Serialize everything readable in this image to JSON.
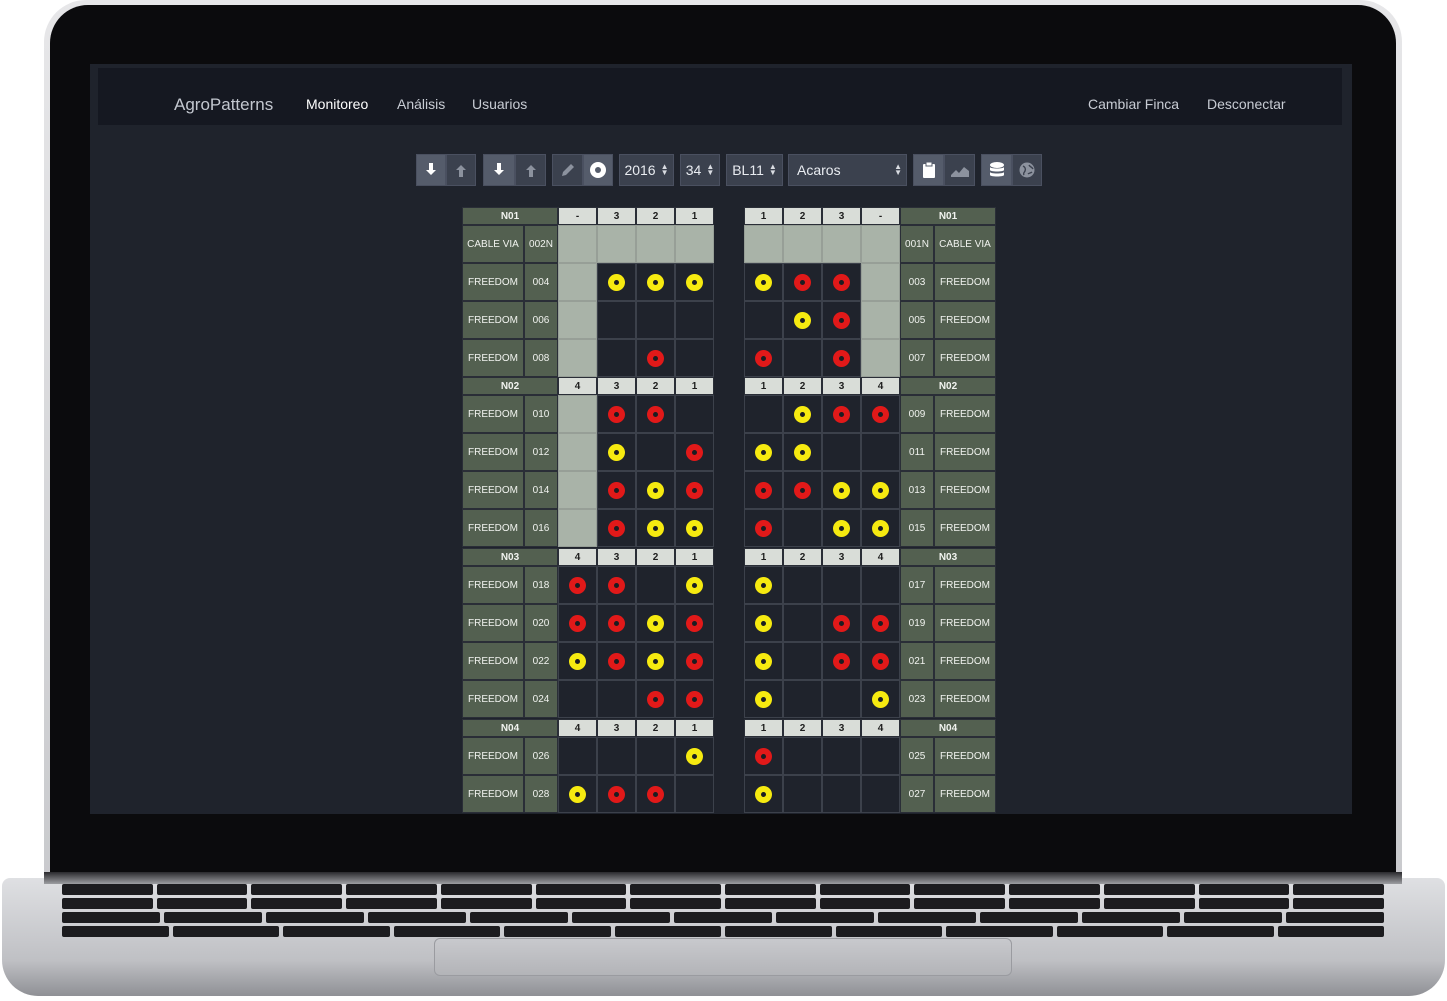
{
  "app": {
    "brand": "AgroPatterns",
    "nav": [
      "Monitoreo",
      "Análisis",
      "Usuarios"
    ],
    "nav_right": [
      "Cambiar Finca",
      "Desconectar"
    ]
  },
  "toolbar": {
    "year": "2016",
    "week": "34",
    "block": "BL11",
    "pest": "Acaros",
    "icons": [
      "download-icon",
      "upload-icon",
      "download-icon",
      "upload-icon",
      "pencil-icon",
      "target-icon",
      "clipboard-icon",
      "area-chart-icon",
      "database-icon",
      "globe-icon"
    ]
  },
  "colors": {
    "red": "#e11919",
    "yellow": "#f6ea10",
    "label_bg": "#536050",
    "empty_bed": "#a9b3a8"
  },
  "grid": {
    "sections": [
      {
        "name": "N01",
        "left_cols": [
          "-",
          "3",
          "2",
          "1"
        ],
        "right_cols": [
          "1",
          "2",
          "3",
          "-"
        ],
        "rows": [
          {
            "l_var": "CABLE VIA",
            "l_id": "002N",
            "left": [
              "g",
              "g",
              "g",
              "g"
            ],
            "right": [
              "g",
              "g",
              "g",
              "g"
            ],
            "r_id": "001N",
            "r_var": "CABLE VIA"
          },
          {
            "l_var": "FREEDOM",
            "l_id": "004",
            "left": [
              "g",
              "y",
              "y",
              "y"
            ],
            "right": [
              "y",
              "r",
              "r",
              "g"
            ],
            "r_id": "003",
            "r_var": "FREEDOM"
          },
          {
            "l_var": "FREEDOM",
            "l_id": "006",
            "left": [
              "g",
              "e",
              "e",
              "e"
            ],
            "right": [
              "e",
              "y",
              "r",
              "g"
            ],
            "r_id": "005",
            "r_var": "FREEDOM"
          },
          {
            "l_var": "FREEDOM",
            "l_id": "008",
            "left": [
              "g",
              "e",
              "r",
              "e"
            ],
            "right": [
              "r",
              "e",
              "r",
              "g"
            ],
            "r_id": "007",
            "r_var": "FREEDOM"
          }
        ]
      },
      {
        "name": "N02",
        "left_cols": [
          "4",
          "3",
          "2",
          "1"
        ],
        "right_cols": [
          "1",
          "2",
          "3",
          "4"
        ],
        "rows": [
          {
            "l_var": "FREEDOM",
            "l_id": "010",
            "left": [
              "g",
              "r",
              "r",
              "e"
            ],
            "right": [
              "e",
              "y",
              "r",
              "r"
            ],
            "r_id": "009",
            "r_var": "FREEDOM"
          },
          {
            "l_var": "FREEDOM",
            "l_id": "012",
            "left": [
              "g",
              "y",
              "e",
              "r"
            ],
            "right": [
              "y",
              "y",
              "e",
              "e"
            ],
            "r_id": "011",
            "r_var": "FREEDOM"
          },
          {
            "l_var": "FREEDOM",
            "l_id": "014",
            "left": [
              "g",
              "r",
              "y",
              "r"
            ],
            "right": [
              "r",
              "r",
              "y",
              "y"
            ],
            "r_id": "013",
            "r_var": "FREEDOM"
          },
          {
            "l_var": "FREEDOM",
            "l_id": "016",
            "left": [
              "g",
              "r",
              "y",
              "y"
            ],
            "right": [
              "r",
              "e",
              "y",
              "y"
            ],
            "r_id": "015",
            "r_var": "FREEDOM"
          }
        ]
      },
      {
        "name": "N03",
        "left_cols": [
          "4",
          "3",
          "2",
          "1"
        ],
        "right_cols": [
          "1",
          "2",
          "3",
          "4"
        ],
        "rows": [
          {
            "l_var": "FREEDOM",
            "l_id": "018",
            "left": [
              "r",
              "r",
              "e",
              "y"
            ],
            "right": [
              "y",
              "e",
              "e",
              "e"
            ],
            "r_id": "017",
            "r_var": "FREEDOM"
          },
          {
            "l_var": "FREEDOM",
            "l_id": "020",
            "left": [
              "r",
              "r",
              "y",
              "r"
            ],
            "right": [
              "y",
              "e",
              "r",
              "r"
            ],
            "r_id": "019",
            "r_var": "FREEDOM"
          },
          {
            "l_var": "FREEDOM",
            "l_id": "022",
            "left": [
              "y",
              "r",
              "y",
              "r"
            ],
            "right": [
              "y",
              "e",
              "r",
              "r"
            ],
            "r_id": "021",
            "r_var": "FREEDOM"
          },
          {
            "l_var": "FREEDOM",
            "l_id": "024",
            "left": [
              "e",
              "e",
              "r",
              "r"
            ],
            "right": [
              "y",
              "e",
              "e",
              "y"
            ],
            "r_id": "023",
            "r_var": "FREEDOM"
          }
        ]
      },
      {
        "name": "N04",
        "left_cols": [
          "4",
          "3",
          "2",
          "1"
        ],
        "right_cols": [
          "1",
          "2",
          "3",
          "4"
        ],
        "rows": [
          {
            "l_var": "FREEDOM",
            "l_id": "026",
            "left": [
              "e",
              "e",
              "e",
              "y"
            ],
            "right": [
              "r",
              "e",
              "e",
              "e"
            ],
            "r_id": "025",
            "r_var": "FREEDOM"
          },
          {
            "l_var": "FREEDOM",
            "l_id": "028",
            "left": [
              "y",
              "r",
              "r",
              "e"
            ],
            "right": [
              "y",
              "e",
              "e",
              "e"
            ],
            "r_id": "027",
            "r_var": "FREEDOM"
          }
        ]
      }
    ]
  }
}
